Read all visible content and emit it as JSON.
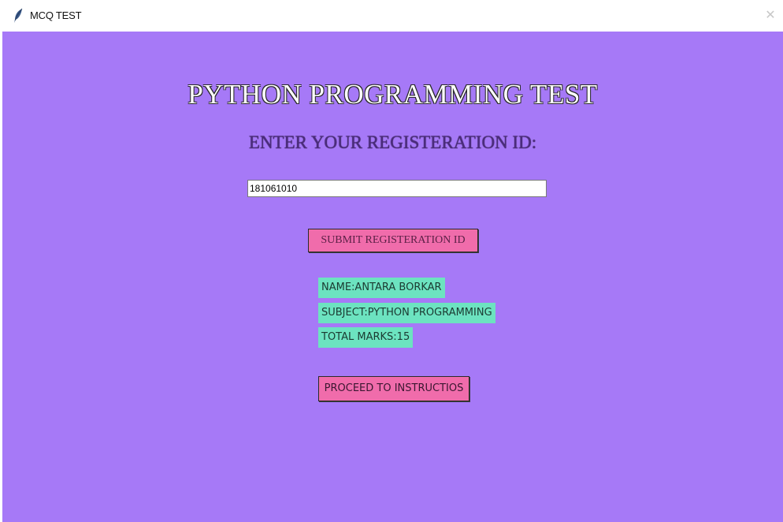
{
  "window": {
    "title": "MCQ TEST",
    "close_glyph": "✕",
    "app_icon": "feather-icon"
  },
  "main": {
    "heading": "PYTHON PROGRAMMING TEST",
    "subheading": "ENTER YOUR REGISTERATION ID:",
    "registration_input": {
      "value": "181061010"
    },
    "submit_button_label": "SUBMIT REGISTERATION ID",
    "info": {
      "name": "NAME:ANTARA BORKAR",
      "subject": "SUBJECT:PYTHON PROGRAMMING",
      "total_marks": "TOTAL MARKS:15"
    },
    "proceed_button_label": "PROCEED TO INSTRUCTIOS"
  },
  "colors": {
    "background": "#a679f7",
    "button": "#f06cab",
    "info_label": "#6ce3c0"
  }
}
